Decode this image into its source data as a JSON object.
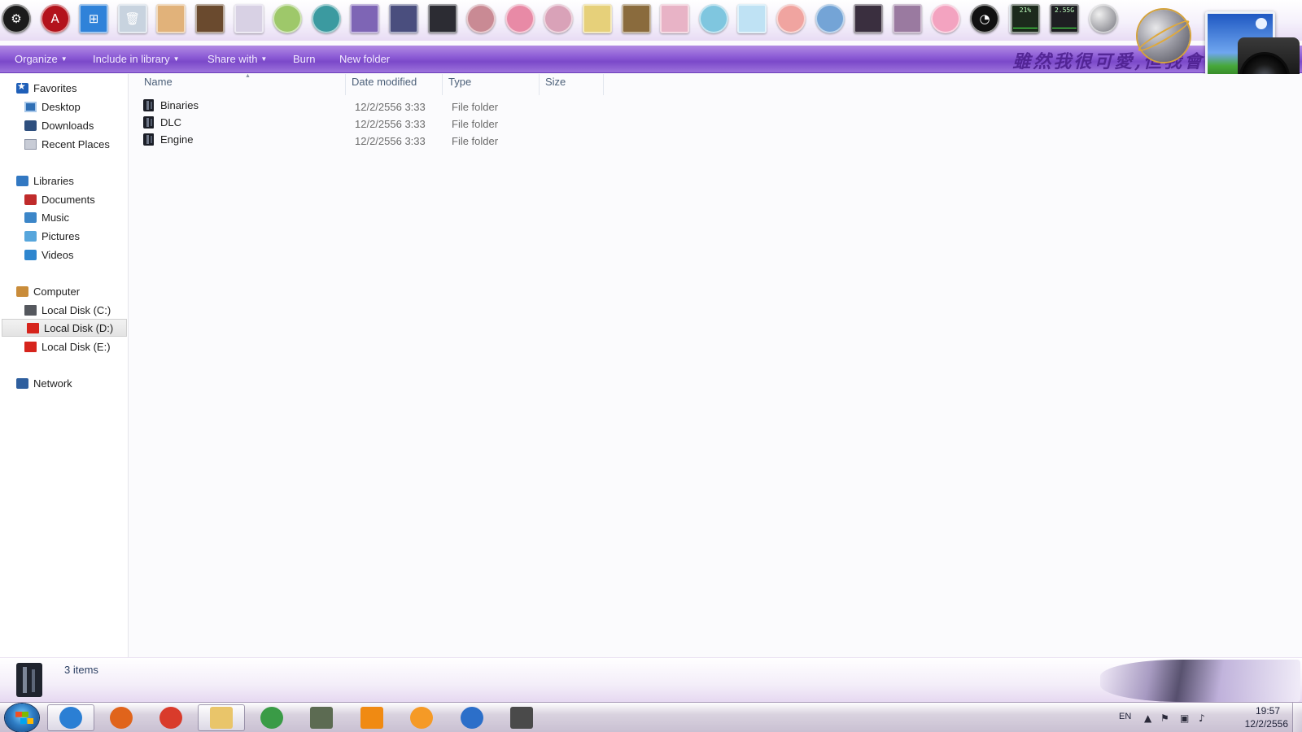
{
  "dock": {
    "icons": [
      {
        "name": "steam-icon",
        "color": "#1b1b1b",
        "shape": "circle",
        "glyph": "⚙"
      },
      {
        "name": "game-launcher-icon",
        "color": "#b3131c",
        "shape": "circle",
        "glyph": "A"
      },
      {
        "name": "windows-logo-icon",
        "color": "#2f82d9",
        "shape": "square",
        "glyph": "⊞"
      },
      {
        "name": "recycle-bin-icon",
        "color": "#c8d3df",
        "shape": "square",
        "glyph": "🗑"
      },
      {
        "name": "anime-shortcut-icon-1",
        "color": "#e1b27a",
        "shape": "square",
        "glyph": ""
      },
      {
        "name": "anime-shortcut-icon-2",
        "color": "#6a4a2e",
        "shape": "square",
        "glyph": ""
      },
      {
        "name": "anime-shortcut-icon-3",
        "color": "#d8d1e4",
        "shape": "square",
        "glyph": ""
      },
      {
        "name": "anime-shortcut-icon-4",
        "color": "#9ec86a",
        "shape": "circle",
        "glyph": ""
      },
      {
        "name": "anime-shortcut-icon-5",
        "color": "#3b9aa0",
        "shape": "circle",
        "glyph": ""
      },
      {
        "name": "anime-shortcut-icon-6",
        "color": "#7e65b5",
        "shape": "square",
        "glyph": ""
      },
      {
        "name": "dvd-icon",
        "color": "#4a4e7e",
        "shape": "square",
        "glyph": ""
      },
      {
        "name": "anime-shortcut-icon-7",
        "color": "#2c2c33",
        "shape": "square",
        "glyph": ""
      },
      {
        "name": "anime-shortcut-icon-8",
        "color": "#c98a94",
        "shape": "circle",
        "glyph": ""
      },
      {
        "name": "anime-shortcut-icon-9",
        "color": "#e88aa6",
        "shape": "circle",
        "glyph": ""
      },
      {
        "name": "anime-shortcut-icon-10",
        "color": "#d9a2b8",
        "shape": "circle",
        "glyph": ""
      },
      {
        "name": "anime-shortcut-icon-11",
        "color": "#e6d07a",
        "shape": "square",
        "glyph": ""
      },
      {
        "name": "anime-shortcut-icon-12",
        "color": "#8a6b3d",
        "shape": "square",
        "glyph": ""
      },
      {
        "name": "anime-shortcut-icon-13",
        "color": "#e8b3c6",
        "shape": "square",
        "glyph": ""
      },
      {
        "name": "anime-shortcut-icon-14",
        "color": "#7fc6df",
        "shape": "circle",
        "glyph": ""
      },
      {
        "name": "anime-shortcut-icon-15",
        "color": "#bfe2f4",
        "shape": "square",
        "glyph": ""
      },
      {
        "name": "anime-shortcut-icon-16",
        "color": "#f0a4a0",
        "shape": "circle",
        "glyph": ""
      },
      {
        "name": "anime-shortcut-icon-17",
        "color": "#74a4d6",
        "shape": "circle",
        "glyph": ""
      },
      {
        "name": "anime-shortcut-icon-18",
        "color": "#3a2f3f",
        "shape": "square",
        "glyph": ""
      },
      {
        "name": "anime-shortcut-icon-19",
        "color": "#9a7aa0",
        "shape": "square",
        "glyph": ""
      },
      {
        "name": "anime-shortcut-icon-20",
        "color": "#f3a3c0",
        "shape": "circle",
        "glyph": ""
      },
      {
        "name": "clock-gadget-icon",
        "color": "#111111",
        "shape": "circle",
        "glyph": "◔"
      },
      {
        "name": "recycle-bin-full-icon",
        "color": "#d1dde8",
        "shape": "square",
        "glyph": "🗑"
      }
    ],
    "cpu_meter": "21%",
    "mem_meter": "2.55G"
  },
  "toolbar": {
    "organize": "Organize",
    "include_in_library": "Include in library",
    "share_with": "Share with",
    "burn": "Burn",
    "new_folder": "New folder"
  },
  "banner_text": "雖然我很可愛,但我會",
  "nav": {
    "favorites": {
      "label": "Favorites",
      "items": [
        "Desktop",
        "Downloads",
        "Recent Places"
      ]
    },
    "libraries": {
      "label": "Libraries",
      "items": [
        "Documents",
        "Music",
        "Pictures",
        "Videos"
      ]
    },
    "computer": {
      "label": "Computer",
      "items": [
        "Local Disk (C:)",
        "Local Disk (D:)",
        "Local Disk (E:)"
      ]
    },
    "network": {
      "label": "Network"
    },
    "selected": "Local Disk (D:)"
  },
  "columns": {
    "name": "Name",
    "date_modified": "Date modified",
    "type": "Type",
    "size": "Size"
  },
  "files": [
    {
      "name": "Binaries",
      "date": "12/2/2556 3:33",
      "type": "File folder"
    },
    {
      "name": "DLC",
      "date": "12/2/2556 3:33",
      "type": "File folder"
    },
    {
      "name": "Engine",
      "date": "12/2/2556 3:33",
      "type": "File folder"
    }
  ],
  "status": {
    "item_count": "3 items"
  },
  "taskbar": {
    "apps": [
      {
        "name": "internet-explorer-taskbar-icon",
        "color": "#2b7fd4",
        "shape": "circle",
        "active": true
      },
      {
        "name": "firefox-taskbar-icon",
        "color": "#e0641b",
        "shape": "circle",
        "active": false
      },
      {
        "name": "chrome-taskbar-icon",
        "color": "#d93b2b",
        "shape": "circle",
        "active": false
      },
      {
        "name": "windows-explorer-taskbar-icon",
        "color": "#e9c56a",
        "shape": "square",
        "active": true
      },
      {
        "name": "internet-download-manager-taskbar-icon",
        "color": "#3a9b46",
        "shape": "circle",
        "active": false
      },
      {
        "name": "task-manager-taskbar-icon",
        "color": "#5c6b52",
        "shape": "square",
        "active": false
      },
      {
        "name": "vlc-taskbar-icon",
        "color": "#f08a12",
        "shape": "square",
        "active": false
      },
      {
        "name": "media-player-taskbar-icon",
        "color": "#f59a26",
        "shape": "circle",
        "active": false
      },
      {
        "name": "daemon-tools-taskbar-icon",
        "color": "#2c6fc9",
        "shape": "circle",
        "active": false
      },
      {
        "name": "monitor-app-taskbar-icon",
        "color": "#4a4a4a",
        "shape": "square",
        "active": false
      }
    ],
    "language": "EN",
    "time": "19:57",
    "date": "12/2/2556"
  }
}
